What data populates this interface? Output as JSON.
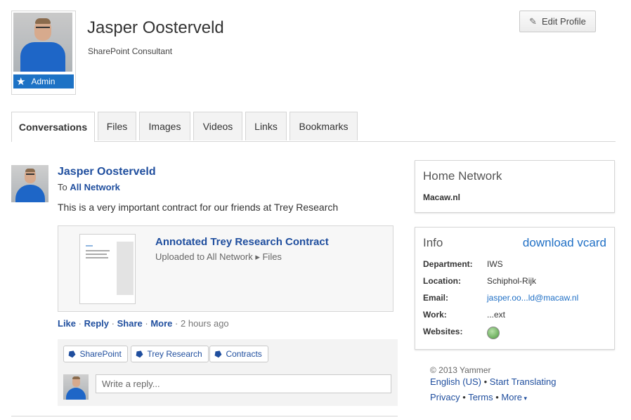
{
  "profile": {
    "name": "Jasper Oosterveld",
    "title": "SharePoint Consultant",
    "badge": "Admin",
    "edit_label": "Edit Profile"
  },
  "tabs": [
    {
      "label": "Conversations",
      "active": true
    },
    {
      "label": "Files",
      "active": false
    },
    {
      "label": "Images",
      "active": false
    },
    {
      "label": "Videos",
      "active": false
    },
    {
      "label": "Links",
      "active": false
    },
    {
      "label": "Bookmarks",
      "active": false
    }
  ],
  "post": {
    "author": "Jasper Oosterveld",
    "to_prefix": "To",
    "to_target": "All Network",
    "body": "This is a very important contract for our friends at Trey Research",
    "attachment": {
      "title": "Annotated Trey Research Contract",
      "subtitle": "Uploaded to All Network ▸ Files"
    },
    "actions": {
      "like": "Like",
      "reply": "Reply",
      "share": "Share",
      "more": "More",
      "separator": "·",
      "time": "2 hours ago"
    },
    "tags": [
      "SharePoint",
      "Trey Research",
      "Contracts"
    ],
    "reply_placeholder": "Write a reply..."
  },
  "home_network": {
    "title": "Home Network",
    "value": "Macaw.nl"
  },
  "info": {
    "title": "Info",
    "vcard_label": "download vcard",
    "rows": [
      {
        "label": "Department:",
        "value": "IWS"
      },
      {
        "label": "Location:",
        "value": "Schiphol-Rijk"
      },
      {
        "label": "Email:",
        "value": "jasper.oo...ld@macaw.nl"
      },
      {
        "label": "Work:",
        "value": "...ext"
      },
      {
        "label": "Websites:",
        "value": ""
      }
    ]
  },
  "footer": {
    "copyright": "© 2013 Yammer",
    "language": "English (US)",
    "translate": "Start Translating",
    "privacy": "Privacy",
    "terms": "Terms",
    "more": "More",
    "dot": "•"
  },
  "colors": {
    "link": "#1f4e9e",
    "admin_badge": "#1d72c5",
    "border": "#d6d6d6"
  }
}
